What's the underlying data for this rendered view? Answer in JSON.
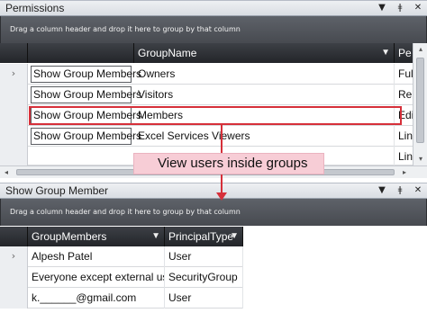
{
  "permissions_panel": {
    "title": "Permissions",
    "title_buttons": [
      "▼",
      "ǂ",
      "✕"
    ],
    "group_hint": "Drag a column header and drop it here to group by that column",
    "columns": [
      {
        "label": "",
        "filter": false
      },
      {
        "label": "GroupName",
        "filter": true
      },
      {
        "label": "Pe",
        "filter": false
      }
    ],
    "rows": [
      {
        "indicator": "›",
        "button": "Show Group Members",
        "group": "Owners",
        "perm": "Ful"
      },
      {
        "indicator": "",
        "button": "Show Group Members",
        "group": "Visitors",
        "perm": "Re"
      },
      {
        "indicator": "",
        "button": "Show Group Members",
        "group": "Members",
        "perm": "Edi"
      },
      {
        "indicator": "",
        "button": "Show Group Members",
        "group": "Excel Services Viewers",
        "perm": "Lin"
      },
      {
        "indicator": "",
        "button": "",
        "group": "",
        "perm": "Lin"
      }
    ]
  },
  "annotation": {
    "callout_text": "View users inside groups",
    "color": "#d6303a",
    "callout_bg": "#f7cdd6"
  },
  "members_panel": {
    "title": "Show Group Member",
    "title_buttons": [
      "▼",
      "ǂ",
      "✕"
    ],
    "group_hint": "Drag a column header and drop it here to group by that column",
    "columns": [
      {
        "label": "GroupMembers",
        "filter": true
      },
      {
        "label": "PrincipalType",
        "filter": true
      }
    ],
    "rows": [
      {
        "indicator": "›",
        "member": "Alpesh Patel",
        "type": "User"
      },
      {
        "indicator": "",
        "member": "Everyone except external users",
        "type": "SecurityGroup"
      },
      {
        "indicator": "",
        "member": "k.______@gmail.com",
        "type": "User"
      }
    ]
  },
  "icons": {
    "filter": "filter-funnel-icon",
    "row_indicator": "chevron-right-icon",
    "scroll_up": "scroll-up-arrow-icon",
    "scroll_down": "scroll-down-arrow-icon",
    "scroll_left": "scroll-left-arrow-icon",
    "scroll_right": "scroll-right-arrow-icon",
    "scroll_left_glyph": "◂",
    "scroll_right_glyph": "▸",
    "scroll_up_glyph": "▴",
    "scroll_down_glyph": "▾",
    "filter_glyph": "▼"
  }
}
